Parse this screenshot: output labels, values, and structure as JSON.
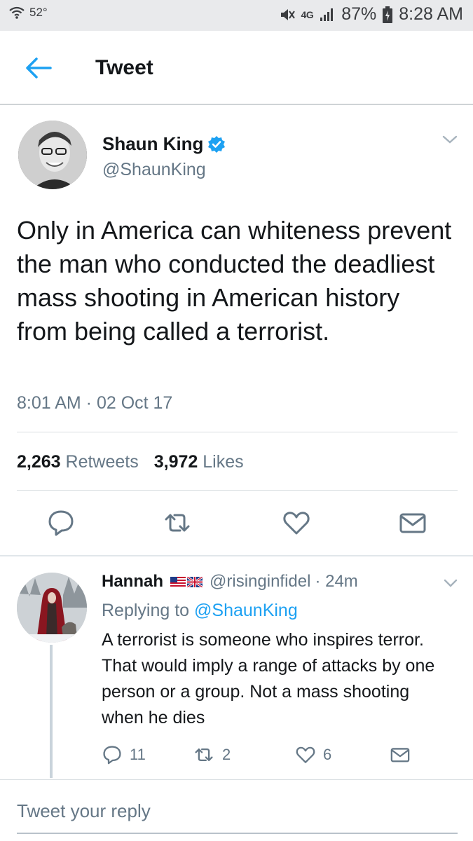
{
  "status_bar": {
    "temperature": "52°",
    "network": "4G",
    "battery": "87%",
    "time": "8:28 AM"
  },
  "header": {
    "title": "Tweet",
    "back_icon": "arrow-left-icon"
  },
  "tweet": {
    "author_name": "Shaun King",
    "author_handle": "@ShaunKing",
    "verified": true,
    "text": "Only in America can whiteness prevent the man who conducted the deadliest mass shooting in American history from being called a terrorist.",
    "timestamp": "8:01 AM · 02 Oct 17",
    "retweets_count": "2,263",
    "retweets_label": "Retweets",
    "likes_count": "3,972",
    "likes_label": "Likes"
  },
  "reply": {
    "author_name": "Hannah",
    "author_handle": "@risinginfidel",
    "time_ago": "· 24m",
    "replying_prefix": "Replying to",
    "replying_to": "@ShaunKing",
    "text": "A terrorist is someone who inspires terror. That would imply a range of attacks by one person or a group. Not a mass shooting when he dies",
    "reply_count": "11",
    "retweet_count": "2",
    "like_count": "6"
  },
  "compose": {
    "placeholder": "Tweet your reply"
  },
  "colors": {
    "accent": "#1da1f2",
    "secondary_text": "#657786",
    "primary_text": "#14171a"
  }
}
